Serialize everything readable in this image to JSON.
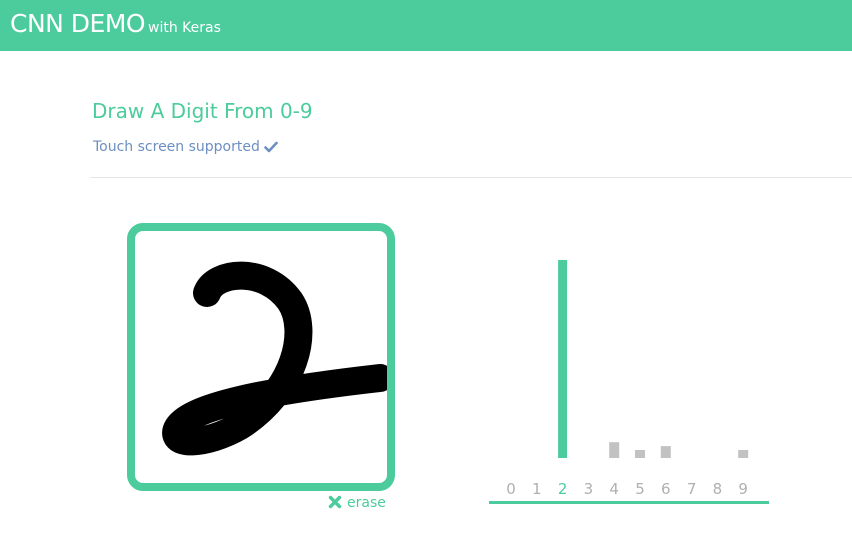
{
  "header": {
    "title": "CNN DEMO",
    "subtitle": "with Keras",
    "bg_color": "#4ccc9c"
  },
  "main": {
    "heading": "Draw A Digit From 0-9",
    "touch_note": "Touch screen supported",
    "touch_icon": "check-icon",
    "erase_label": "erase",
    "erase_icon": "x-icon",
    "accent_color": "#4ccc9c",
    "note_color": "#6c8fc2"
  },
  "chart_data": {
    "type": "bar",
    "categories": [
      "0",
      "1",
      "2",
      "3",
      "4",
      "5",
      "6",
      "7",
      "8",
      "9"
    ],
    "values": [
      0.0,
      0.0,
      1.0,
      0.0,
      0.08,
      0.04,
      0.06,
      0.0,
      0.0,
      0.04
    ],
    "highlight_index": 2,
    "highlight_color": "#4ccc9c",
    "bar_color": "#c2c2c2",
    "label_color": "#b0b0b0",
    "ylim": [
      0,
      1
    ]
  }
}
